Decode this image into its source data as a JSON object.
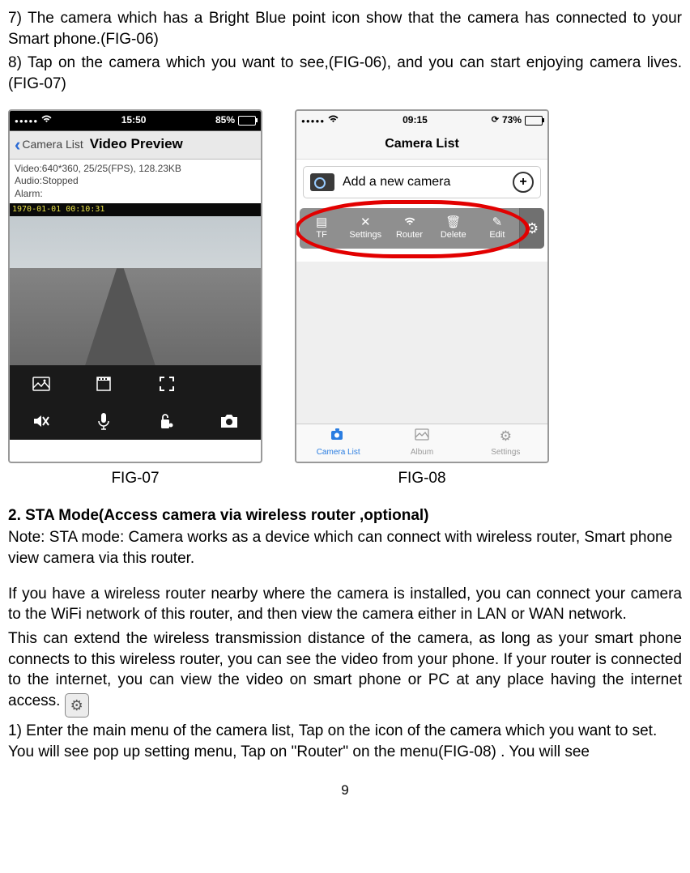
{
  "intro": {
    "line7": "7)  The camera which has a Bright Blue point  icon show that the camera has connected to your Smart phone.(FIG-06)",
    "line8": "8)  Tap on the camera which you want to see,(FIG-06), and you can start enjoying camera lives. (FIG-07)"
  },
  "fig07": {
    "status": {
      "time": "15:50",
      "battery": "85%"
    },
    "back_label": "Camera List",
    "title": "Video Preview",
    "meta": {
      "video": "Video:640*360, 25/25(FPS), 128.23KB",
      "audio": "Audio:Stopped",
      "alarm": "Alarm:"
    },
    "timestamp": "1970-01-01 00:10:31",
    "caption": "FIG-07"
  },
  "fig08": {
    "status": {
      "time": "09:15",
      "battery": "73%"
    },
    "title": "Camera List",
    "add_label": "Add a new camera",
    "popup": {
      "tf": "TF",
      "settings": "Settings",
      "router": "Router",
      "del": "Delete",
      "edit": "Edit"
    },
    "tabs": {
      "camlist": "Camera List",
      "album": "Album",
      "settings": "Settings"
    },
    "caption": "FIG-08"
  },
  "section": {
    "heading": "2.  STA Mode(Access camera via wireless router ,optional)",
    "note": "Note: STA mode: Camera works as a device which can connect with wireless router, Smart phone view camera via this router.",
    "p1": "If you have a wireless router nearby where the camera is installed, you can connect your camera to the WiFi network of this router, and then view the camera either in LAN or WAN network.",
    "p2a": "This can extend the wireless transmission distance of the camera, as long as your smart phone connects to this wireless router, you can see the video from your phone. If your router is connected to the internet, you can view the video on smart phone or PC at any place having the internet access. ",
    "step1": "1)  Enter the main menu of the camera list, Tap on the icon of the camera which you want to set.  You will see pop up setting menu, Tap on \"Router\" on the menu(FIG-08) . You will see"
  },
  "pagenum": "9"
}
